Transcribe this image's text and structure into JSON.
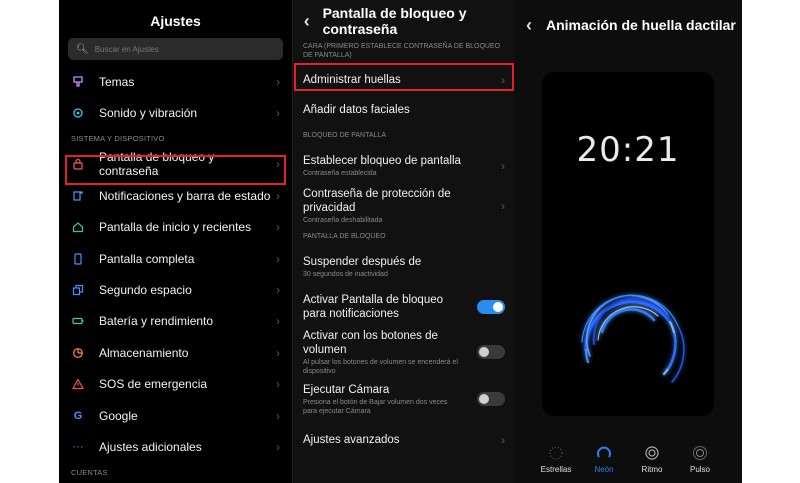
{
  "left": {
    "title": "Ajustes",
    "search_placeholder": "Buscar en Ajustes",
    "items_top": [
      {
        "label": "Temas",
        "icon": "brush-icon",
        "color": "#c58cff"
      },
      {
        "label": "Sonido y vibración",
        "icon": "speaker-icon",
        "color": "#35c6e6"
      }
    ],
    "section_system": "Sistema y dispositivo",
    "items_system": [
      {
        "label": "Pantalla de bloqueo y contraseña",
        "icon": "lock-icon",
        "color": "#ff5a5a"
      },
      {
        "label": "Notificaciones y barra de estado",
        "icon": "notification-icon",
        "color": "#3c9cff"
      },
      {
        "label": "Pantalla de inicio y recientes",
        "icon": "home-icon",
        "color": "#32c8a0"
      },
      {
        "label": "Pantalla completa",
        "icon": "fullscreen-icon",
        "color": "#4a90ff"
      },
      {
        "label": "Segundo espacio",
        "icon": "second-space-icon",
        "color": "#4a90ff"
      },
      {
        "label": "Batería y rendimiento",
        "icon": "battery-icon",
        "color": "#47d47a"
      },
      {
        "label": "Almacenamiento",
        "icon": "storage-icon",
        "color": "#ff8a3c"
      },
      {
        "label": "SOS de emergencia",
        "icon": "warning-icon",
        "color": "#ff4a4a"
      },
      {
        "label": "Google",
        "icon": "google-icon",
        "color": "#4a90ff"
      },
      {
        "label": "Ajustes adicionales",
        "icon": "more-icon",
        "color": "#4a90ff"
      }
    ],
    "section_accounts": "Cuentas"
  },
  "middle": {
    "title": "Pantalla de bloqueo y contraseña",
    "section_face": "Cara (primero establece contraseña de bloqueo de pantalla)",
    "manage_fingerprints": "Administrar huellas",
    "add_face": "Añadir datos faciales",
    "section_lock": "Bloqueo de pantalla",
    "set_lock": {
      "title": "Establecer bloqueo de pantalla",
      "sub": "Contraseña establecida"
    },
    "privacy": {
      "title": "Contraseña de protección de privacidad",
      "sub": "Contraseña deshabilitada"
    },
    "section_lockscreen": "Pantalla de bloqueo",
    "sleep": {
      "title": "Suspender después de",
      "sub": "30 segundos de inactividad"
    },
    "notif_toggle": {
      "title": "Activar Pantalla de bloqueo para notificaciones",
      "on": true
    },
    "volume_toggle": {
      "title": "Activar con los botones de volumen",
      "sub": "Al pulsar los botones de volumen se encenderá el dispositivo",
      "on": false
    },
    "camera_toggle": {
      "title": "Ejecutar Cámara",
      "sub": "Presiona el botón de Bajar volumen dos veces para ejecutar Cámara",
      "on": false
    },
    "advanced": "Ajustes avanzados"
  },
  "right": {
    "title": "Animación de huella dactilar",
    "time": "20:21",
    "options": [
      {
        "label": "Estrellas",
        "selected": false
      },
      {
        "label": "Neón",
        "selected": true
      },
      {
        "label": "Ritmo",
        "selected": false
      },
      {
        "label": "Pulso",
        "selected": false
      }
    ],
    "accent": "#2f7ff0"
  }
}
